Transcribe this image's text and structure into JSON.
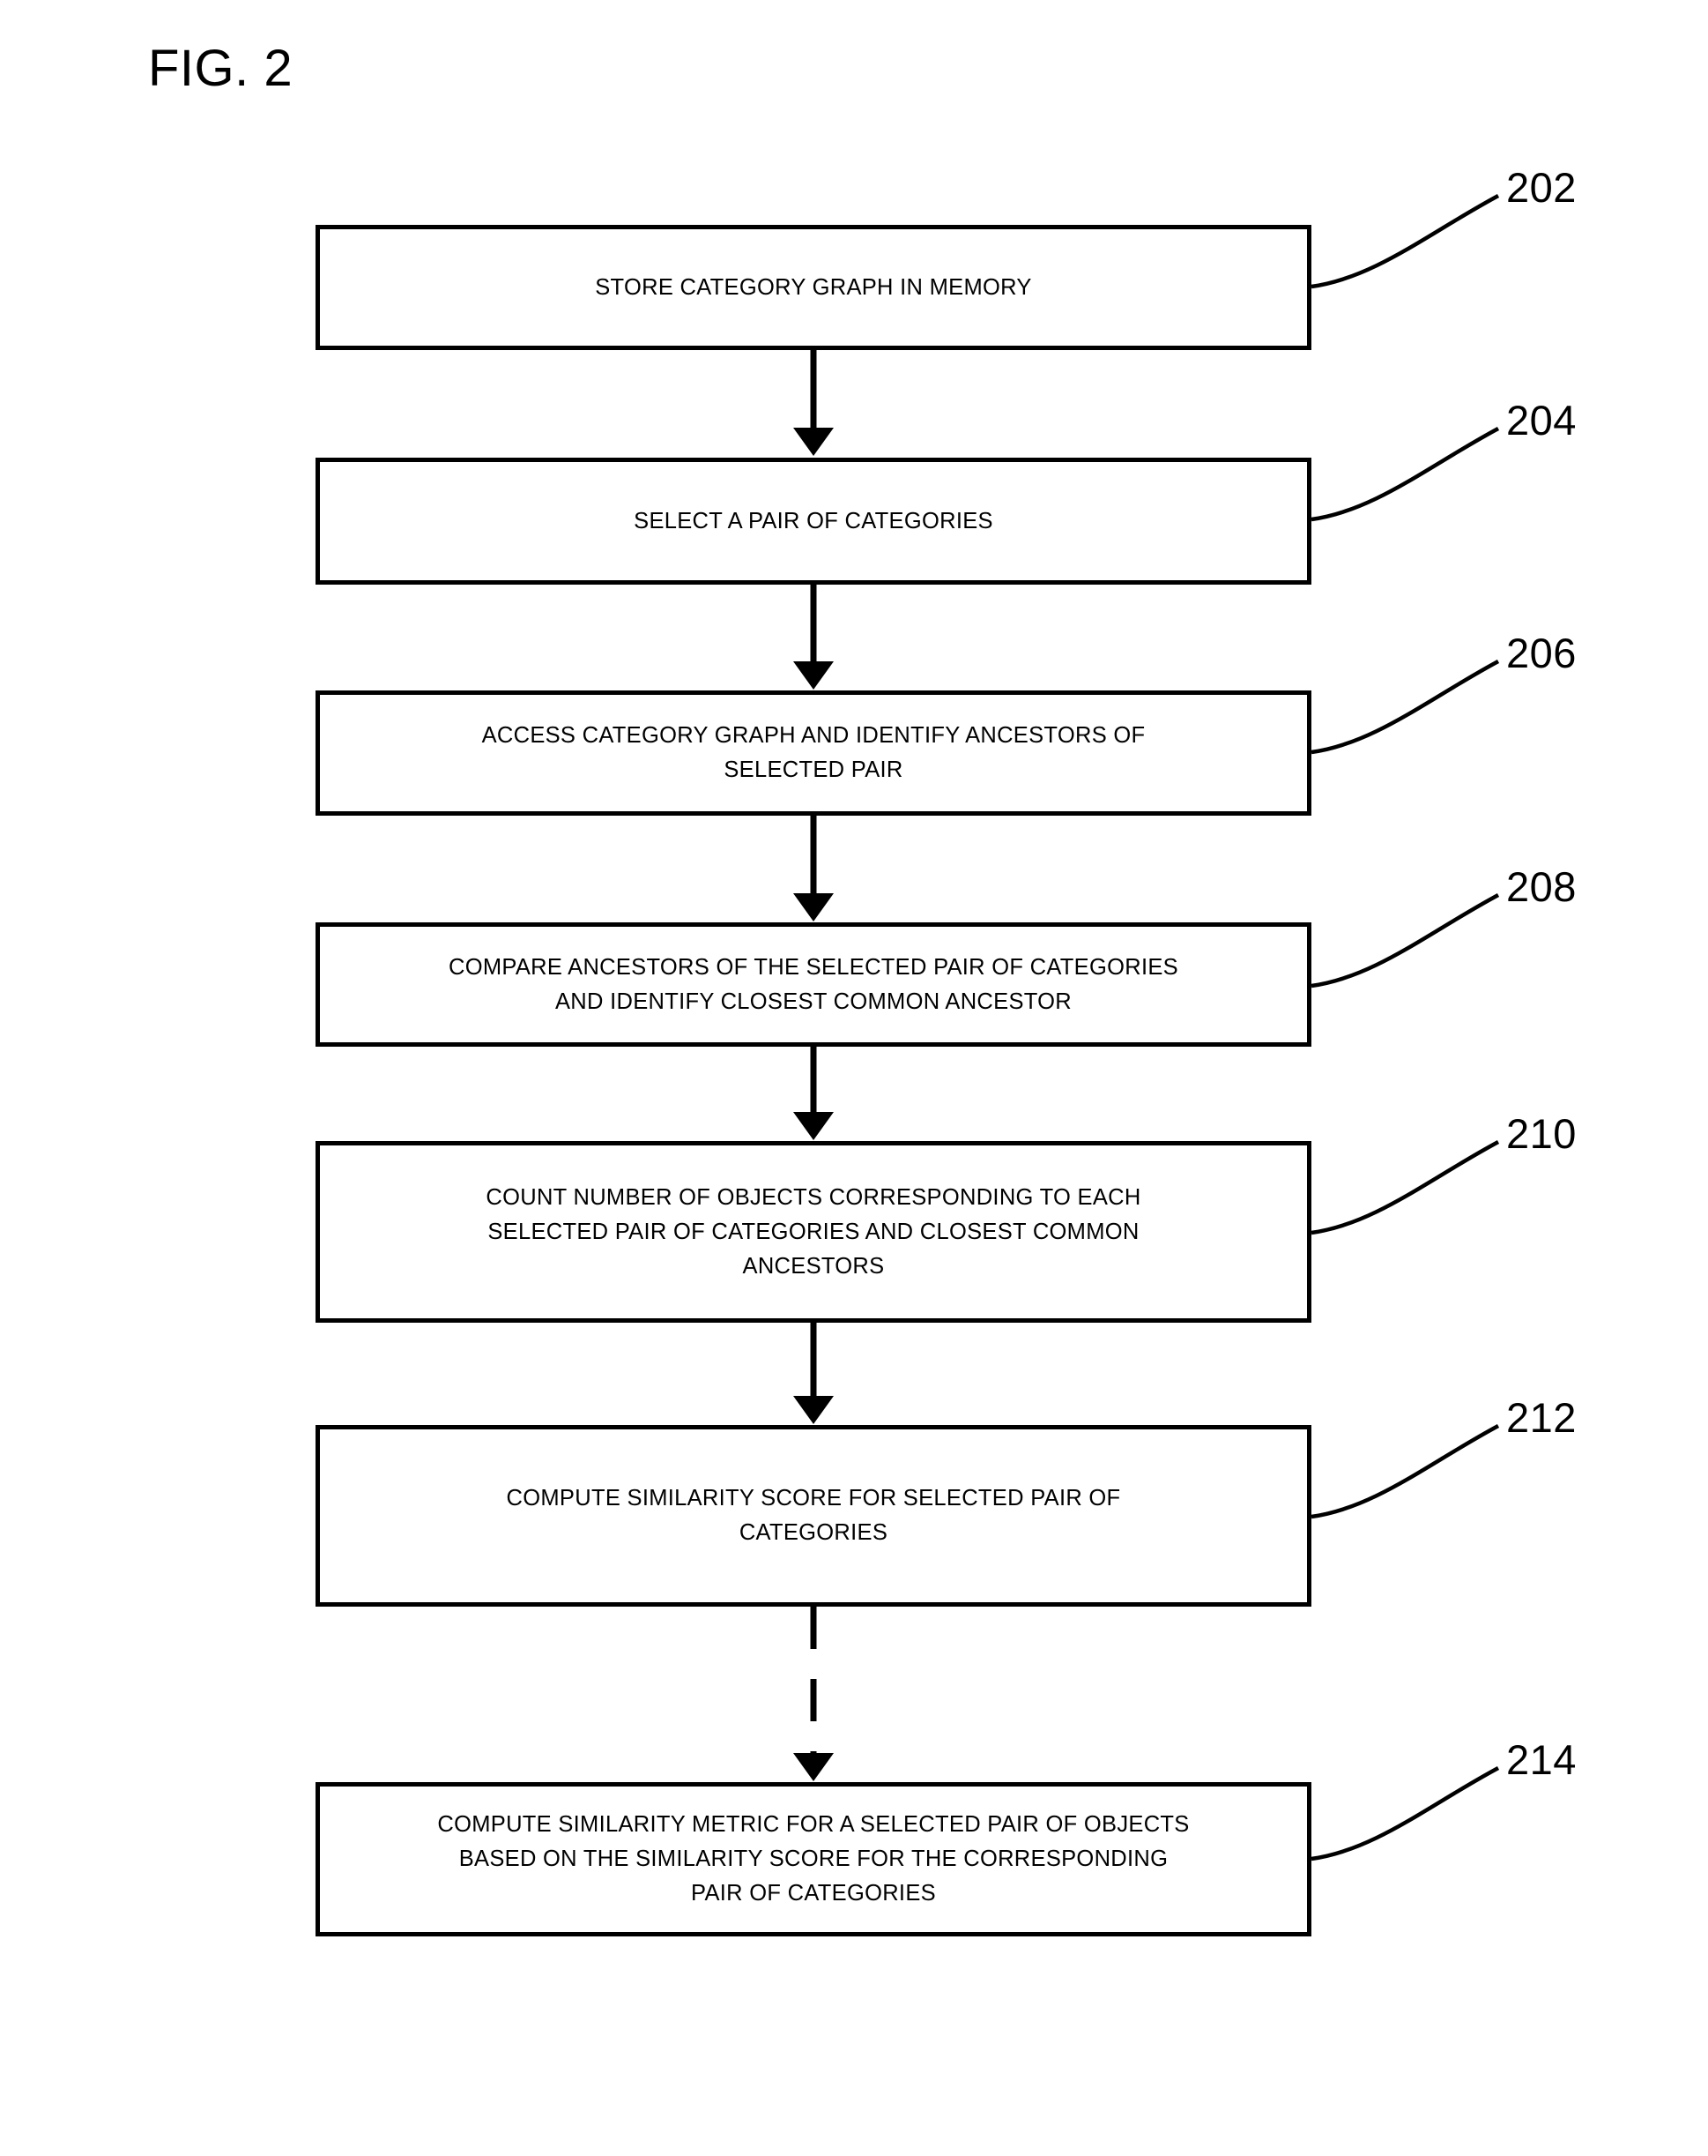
{
  "figure": {
    "title": "FIG. 2",
    "type": "patent-flowchart",
    "ink_color": "#000000",
    "background_color": "#ffffff"
  },
  "steps": [
    {
      "ref": "202",
      "text": "STORE CATEGORY GRAPH IN MEMORY",
      "lines": [
        "STORE CATEGORY GRAPH IN MEMORY"
      ]
    },
    {
      "ref": "204",
      "text": "SELECT A PAIR OF CATEGORIES",
      "lines": [
        "SELECT A PAIR OF CATEGORIES"
      ]
    },
    {
      "ref": "206",
      "text": "ACCESS CATEGORY GRAPH AND IDENTIFY ANCESTORS OF\nSELECTED PAIR",
      "lines": [
        "ACCESS CATEGORY GRAPH AND IDENTIFY ANCESTORS OF",
        "SELECTED PAIR"
      ]
    },
    {
      "ref": "208",
      "text": "COMPARE ANCESTORS OF THE SELECTED PAIR OF CATEGORIES\nAND IDENTIFY CLOSEST COMMON ANCESTOR",
      "lines": [
        "COMPARE ANCESTORS OF THE SELECTED PAIR OF CATEGORIES",
        "AND IDENTIFY CLOSEST COMMON ANCESTOR"
      ]
    },
    {
      "ref": "210",
      "text": "COUNT NUMBER OF OBJECTS CORRESPONDING TO EACH\nSELECTED PAIR OF CATEGORIES AND CLOSEST COMMON\nANCESTORS",
      "lines": [
        "COUNT NUMBER OF OBJECTS CORRESPONDING TO EACH",
        "SELECTED PAIR OF CATEGORIES AND CLOSEST COMMON",
        "ANCESTORS"
      ]
    },
    {
      "ref": "212",
      "text": "COMPUTE SIMILARITY SCORE FOR SELECTED PAIR OF\nCATEGORIES",
      "lines": [
        "COMPUTE SIMILARITY SCORE FOR SELECTED PAIR OF",
        "CATEGORIES"
      ]
    },
    {
      "ref": "214",
      "text": "COMPUTE SIMILARITY METRIC FOR A SELECTED PAIR OF OBJECTS\nBASED ON THE SIMILARITY SCORE FOR THE CORRESPONDING\nPAIR OF CATEGORIES",
      "lines": [
        "COMPUTE SIMILARITY METRIC FOR A SELECTED PAIR OF OBJECTS",
        "BASED ON THE SIMILARITY SCORE FOR THE CORRESPONDING",
        "PAIR OF CATEGORIES"
      ]
    }
  ],
  "connectors": [
    {
      "from": "202",
      "to": "204",
      "style": "solid",
      "arrow": "down"
    },
    {
      "from": "204",
      "to": "206",
      "style": "solid",
      "arrow": "down"
    },
    {
      "from": "206",
      "to": "208",
      "style": "solid",
      "arrow": "down"
    },
    {
      "from": "208",
      "to": "210",
      "style": "solid",
      "arrow": "down"
    },
    {
      "from": "210",
      "to": "212",
      "style": "solid",
      "arrow": "down"
    },
    {
      "from": "212",
      "to": "214",
      "style": "dashed",
      "arrow": "down"
    }
  ]
}
